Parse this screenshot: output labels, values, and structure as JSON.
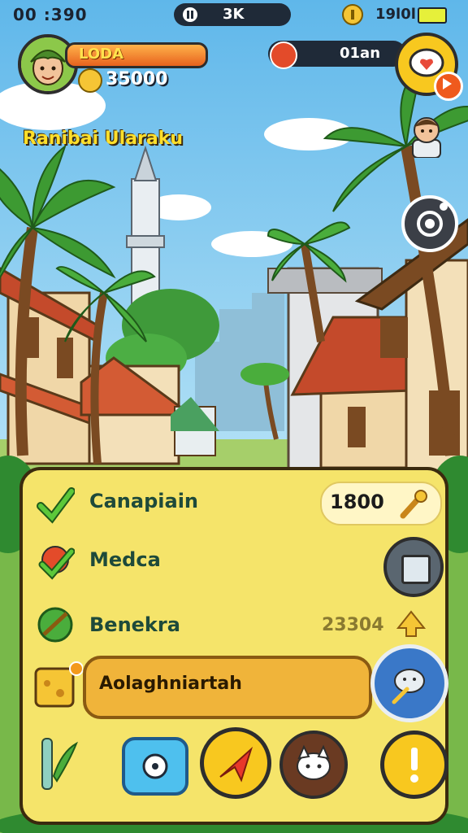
{
  "status_bar": {
    "time": "00 :390",
    "center_label": "3K",
    "right_label": "19l0l",
    "colors": {
      "pill": "#1f2a38",
      "battery": "#e6f03a"
    }
  },
  "profile": {
    "name": "LODA",
    "coins": "35000",
    "avatar_icon": "player-avatar-icon"
  },
  "quest": {
    "label": "01an",
    "icon": "character-icon"
  },
  "location_title": "Ranibai Ularaku",
  "side_buttons": {
    "chat_icon": "heart-chat-icon",
    "play_icon": "play-icon",
    "friend_icon": "friend-portrait-icon",
    "camera_icon": "camera-icon"
  },
  "panel": {
    "rows": [
      {
        "label": "Canapiain",
        "icon": "check-icon",
        "value": "1800",
        "value_icon": "wrench-icon"
      },
      {
        "label": "Medca",
        "icon": "check-badge-icon",
        "action_icon": "square-button-icon"
      },
      {
        "label": "Benekra",
        "icon": "leaf-badge-icon",
        "value": "23304",
        "value_icon": "up-arrow-icon"
      },
      {
        "label": "Aolaghniartah",
        "icon": "cheese-map-icon",
        "action_icon": "elephant-badge-icon"
      }
    ],
    "bottom_icons": [
      "pencil-icon",
      "shield-chat-icon",
      "arrow-icon",
      "cat-icon",
      "alert-icon"
    ],
    "colors": {
      "panel_bg": "#f5e46a",
      "border": "#3a2a0e",
      "highlight": "#f0b43a",
      "label": "#1e4a3a"
    }
  }
}
